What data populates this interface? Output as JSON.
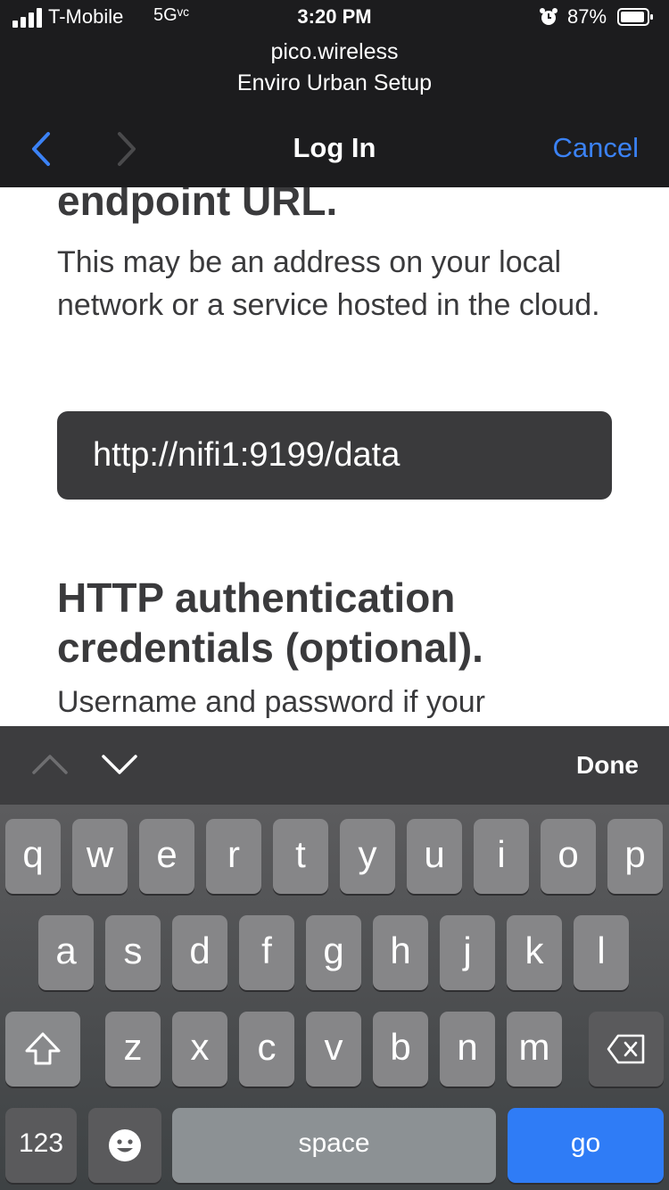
{
  "status_bar": {
    "carrier": "T-Mobile",
    "network": "5Gᵛᶜ",
    "time": "3:20 PM",
    "battery": "87%"
  },
  "header": {
    "host": "pico.wireless",
    "subtitle": "Enviro Urban Setup",
    "title": "Log In",
    "cancel": "Cancel"
  },
  "content": {
    "endpoint_heading": "endpoint URL.",
    "endpoint_desc": "This may be an address on your local network or a service hosted in the cloud.",
    "url_value": "http://nifi1:9199/data",
    "auth_heading": "HTTP authentication credentials (optional).",
    "auth_desc": "Username and password if your"
  },
  "accessory": {
    "done": "Done"
  },
  "keyboard": {
    "row1": [
      "q",
      "w",
      "e",
      "r",
      "t",
      "y",
      "u",
      "i",
      "o",
      "p"
    ],
    "row2": [
      "a",
      "s",
      "d",
      "f",
      "g",
      "h",
      "j",
      "k",
      "l"
    ],
    "row3": [
      "z",
      "x",
      "c",
      "v",
      "b",
      "n",
      "m"
    ],
    "numbers": "123",
    "space": "space",
    "go": "go"
  },
  "colors": {
    "accent": "#3b82f6",
    "go_key": "#2f7cf6",
    "header_bg": "#1c1c1e"
  }
}
